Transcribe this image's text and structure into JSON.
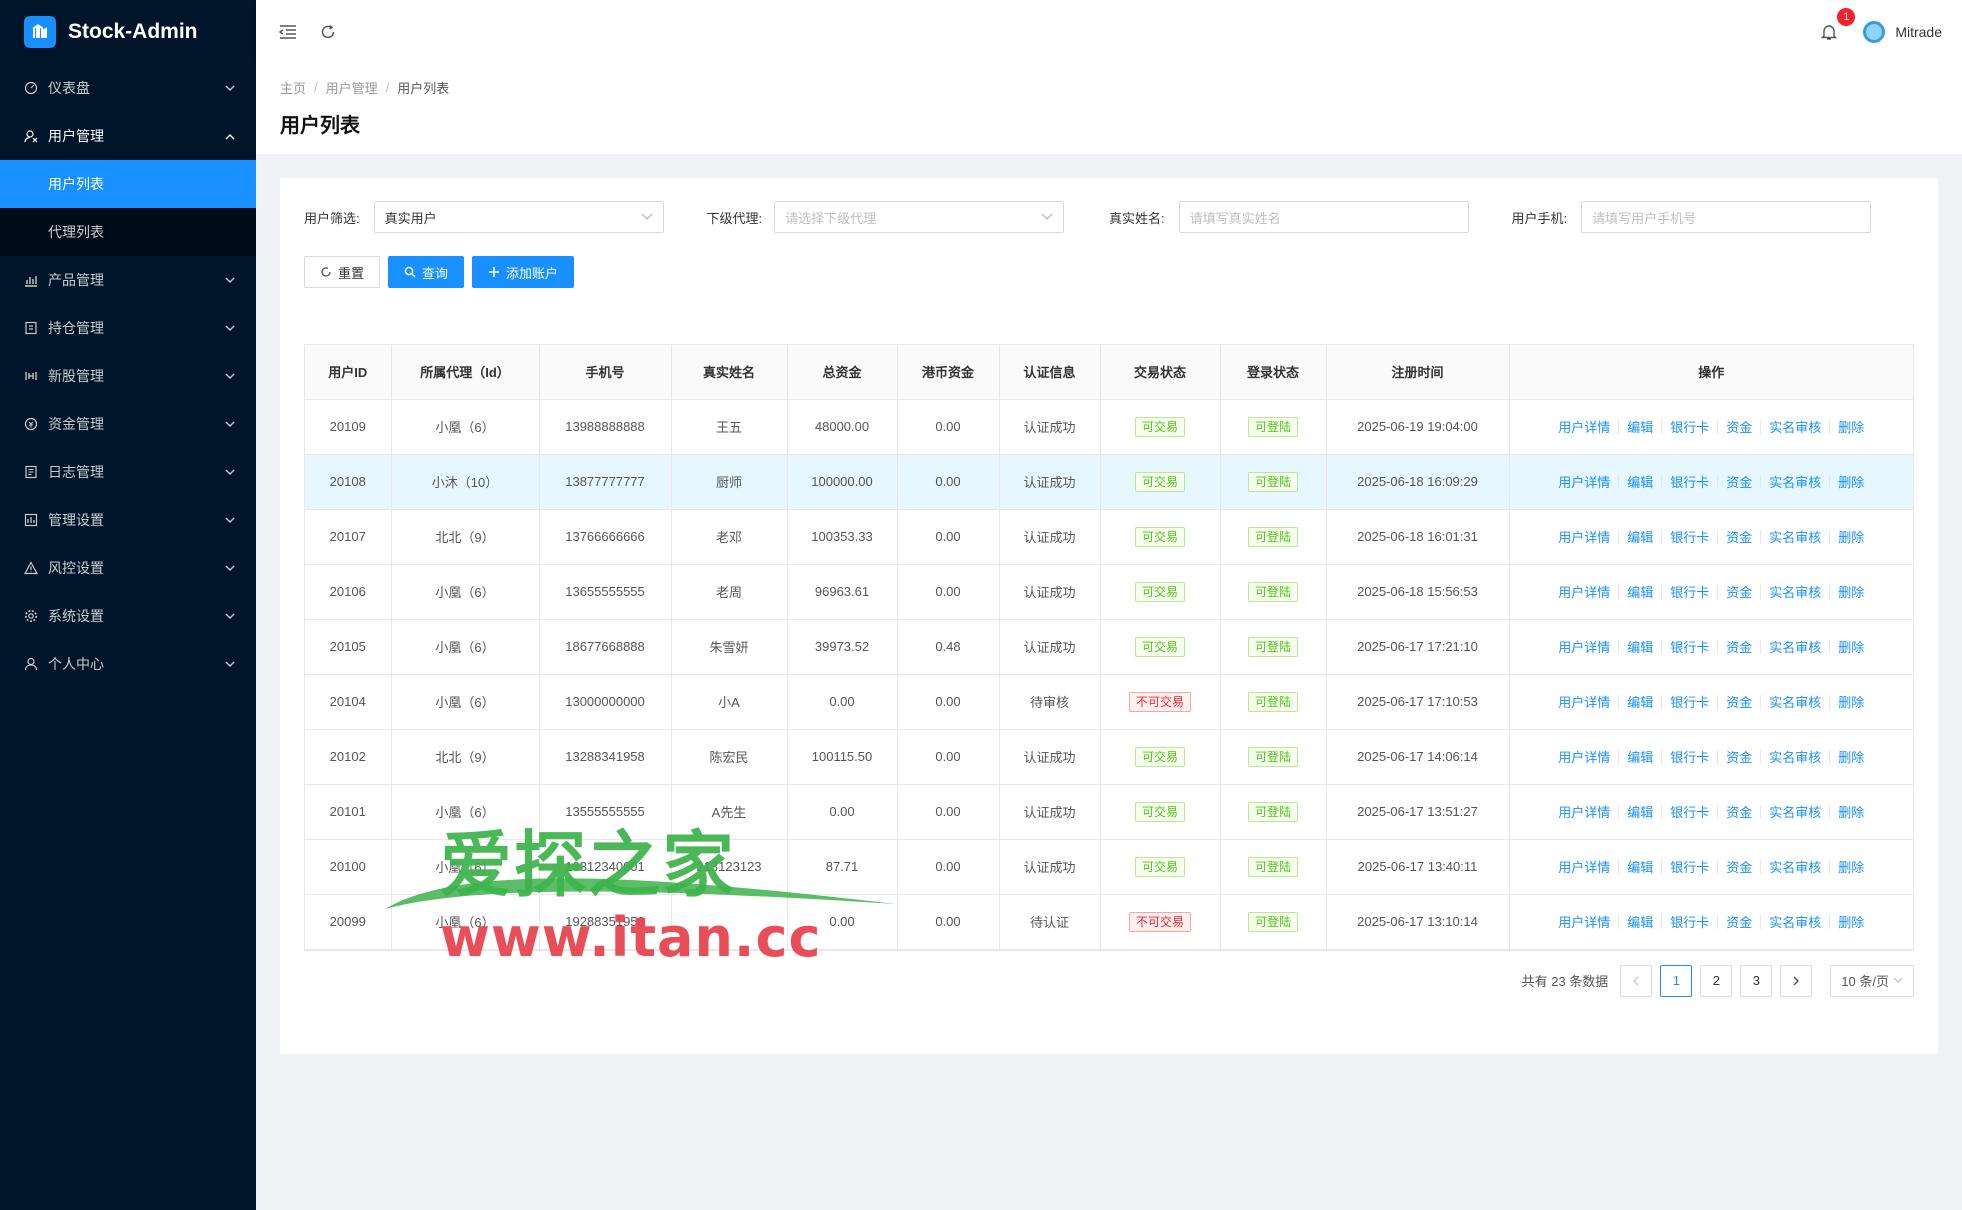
{
  "app": {
    "title": "Stock-Admin"
  },
  "sidebar": {
    "items": [
      {
        "label": "仪表盘",
        "icon": "dashboard-icon"
      },
      {
        "label": "用户管理",
        "icon": "user-manage-icon",
        "open": true,
        "children": [
          {
            "label": "用户列表",
            "active": true
          },
          {
            "label": "代理列表"
          }
        ]
      },
      {
        "label": "产品管理",
        "icon": "bar-chart-icon"
      },
      {
        "label": "持仓管理",
        "icon": "position-icon"
      },
      {
        "label": "新股管理",
        "icon": "ipo-icon"
      },
      {
        "label": "资金管理",
        "icon": "money-icon"
      },
      {
        "label": "日志管理",
        "icon": "log-icon"
      },
      {
        "label": "管理设置",
        "icon": "admin-settings-icon"
      },
      {
        "label": "风控设置",
        "icon": "warning-icon"
      },
      {
        "label": "系统设置",
        "icon": "gear-icon"
      },
      {
        "label": "个人中心",
        "icon": "person-icon"
      }
    ]
  },
  "header": {
    "notification_count": "1",
    "user_name": "Mitrade"
  },
  "breadcrumb": {
    "home": "主页",
    "section": "用户管理",
    "current": "用户列表"
  },
  "page": {
    "title": "用户列表"
  },
  "filters": {
    "user_filter": {
      "label": "用户筛选:",
      "value": "真实用户"
    },
    "agent": {
      "label": "下级代理:",
      "placeholder": "请选择下级代理"
    },
    "real_name": {
      "label": "真实姓名:",
      "placeholder": "请填写真实姓名"
    },
    "phone": {
      "label": "用户手机:",
      "placeholder": "请填写用户手机号"
    }
  },
  "buttons": {
    "reset": "重置",
    "search": "查询",
    "add": "添加账户"
  },
  "table": {
    "columns": [
      "用户ID",
      "所属代理（Id）",
      "手机号",
      "真实姓名",
      "总资金",
      "港币资金",
      "认证信息",
      "交易状态",
      "登录状态",
      "注册时间",
      "操作"
    ],
    "rows": [
      {
        "id": "20109",
        "agent": "小凰（6）",
        "phone": "13988888888",
        "name": "王五",
        "total": "48000.00",
        "hkd": "0.00",
        "auth": "认证成功",
        "trade": "可交易",
        "trade_ok": true,
        "login": "可登陆",
        "time": "2025-06-19 19:04:00"
      },
      {
        "id": "20108",
        "agent": "小沐（10）",
        "phone": "13877777777",
        "name": "厨师",
        "total": "100000.00",
        "hkd": "0.00",
        "auth": "认证成功",
        "trade": "可交易",
        "trade_ok": true,
        "login": "可登陆",
        "time": "2025-06-18 16:09:29"
      },
      {
        "id": "20107",
        "agent": "北北（9）",
        "phone": "13766666666",
        "name": "老邓",
        "total": "100353.33",
        "hkd": "0.00",
        "auth": "认证成功",
        "trade": "可交易",
        "trade_ok": true,
        "login": "可登陆",
        "time": "2025-06-18 16:01:31"
      },
      {
        "id": "20106",
        "agent": "小凰（6）",
        "phone": "13655555555",
        "name": "老周",
        "total": "96963.61",
        "hkd": "0.00",
        "auth": "认证成功",
        "trade": "可交易",
        "trade_ok": true,
        "login": "可登陆",
        "time": "2025-06-18 15:56:53"
      },
      {
        "id": "20105",
        "agent": "小凰（6）",
        "phone": "18677668888",
        "name": "朱雪妍",
        "total": "39973.52",
        "hkd": "0.48",
        "auth": "认证成功",
        "trade": "可交易",
        "trade_ok": true,
        "login": "可登陆",
        "time": "2025-06-17 17:21:10"
      },
      {
        "id": "20104",
        "agent": "小凰（6）",
        "phone": "13000000000",
        "name": "小A",
        "total": "0.00",
        "hkd": "0.00",
        "auth": "待审核",
        "trade": "不可交易",
        "trade_ok": false,
        "login": "可登陆",
        "time": "2025-06-17 17:10:53"
      },
      {
        "id": "20102",
        "agent": "北北（9）",
        "phone": "13288341958",
        "name": "陈宏民",
        "total": "100115.50",
        "hkd": "0.00",
        "auth": "认证成功",
        "trade": "可交易",
        "trade_ok": true,
        "login": "可登陆",
        "time": "2025-06-17 14:06:14"
      },
      {
        "id": "20101",
        "agent": "小凰（6）",
        "phone": "13555555555",
        "name": "A先生",
        "total": "0.00",
        "hkd": "0.00",
        "auth": "认证成功",
        "trade": "可交易",
        "trade_ok": true,
        "login": "可登陆",
        "time": "2025-06-17 13:51:27"
      },
      {
        "id": "20100",
        "agent": "小凰（6）",
        "phone": "13312340001",
        "name": "213123123",
        "total": "87.71",
        "hkd": "0.00",
        "auth": "认证成功",
        "trade": "可交易",
        "trade_ok": true,
        "login": "可登陆",
        "time": "2025-06-17 13:40:11"
      },
      {
        "id": "20099",
        "agent": "小凰（6）",
        "phone": "19288351958",
        "name": "",
        "total": "0.00",
        "hkd": "0.00",
        "auth": "待认证",
        "trade": "不可交易",
        "trade_ok": false,
        "login": "可登陆",
        "time": "2025-06-17 13:10:14"
      }
    ],
    "actions": [
      "用户详情",
      "编辑",
      "银行卡",
      "资金",
      "实名审核",
      "删除"
    ]
  },
  "pagination": {
    "total_text": "共有 23 条数据",
    "pages": [
      "1",
      "2",
      "3"
    ],
    "current": "1",
    "page_size": "10 条/页"
  },
  "watermark": {
    "line1": "爱探之家",
    "line2": "www.itan.cc"
  },
  "colors": {
    "primary": "#1890ff",
    "sidebar_bg": "#001529",
    "success": "#52c41a",
    "danger": "#f5222d"
  }
}
